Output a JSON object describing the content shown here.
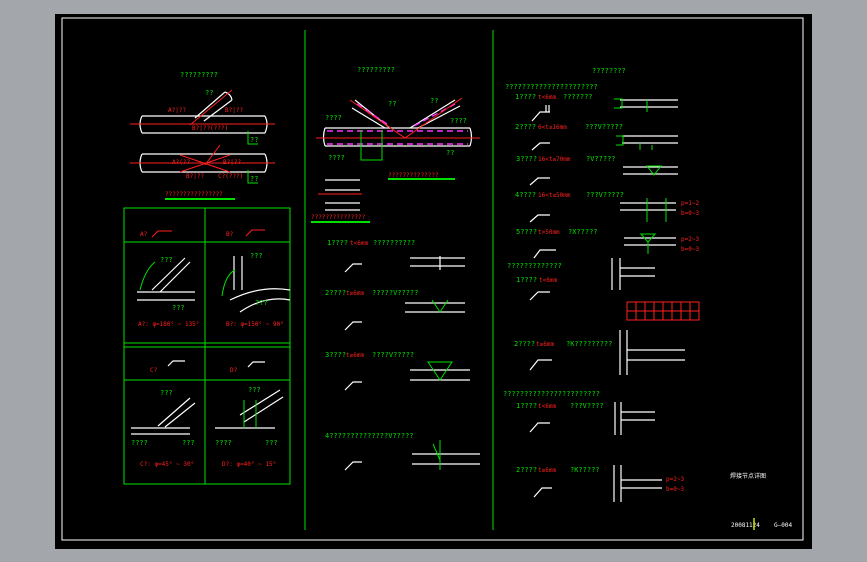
{
  "colors": {
    "background": "#a3a6aa",
    "sheet": "#000000",
    "accent_green": "#00e000",
    "accent_red": "#ff2020",
    "line_white": "#ffffff"
  },
  "left": {
    "title": "?????????",
    "labels": [
      "??",
      "A?|??",
      "B?|??",
      "B?|??(???)",
      "??",
      "A?(??",
      "B?|??",
      "B?|??",
      "C?(???)",
      "??"
    ],
    "caption": "????????????????",
    "table": {
      "cells": [
        {
          "id": "A?",
          "range": "A?: φ=180° ~ 135°",
          "top": "???",
          "bottom": "???"
        },
        {
          "id": "B?",
          "range": "B?: φ=150° ~ 90°",
          "top": "???",
          "bottom": "???"
        },
        {
          "id": "C?",
          "range": "C?: φ=45° ~ 30°",
          "top": "???",
          "bottom": "????",
          "bottom2": "???"
        },
        {
          "id": "D?",
          "range": "D?: φ=40° ~ 15°",
          "top": "???",
          "bottom": "????",
          "bottom2": "???"
        }
      ]
    }
  },
  "middle": {
    "title": "?????????",
    "labels": [
      "????",
      "??",
      "??",
      "????",
      "????",
      "??"
    ],
    "caption1": "??????????????",
    "caption2": "???????????????",
    "rows": [
      {
        "num": "1????",
        "spec": "t<6mm",
        "type": "??????????"
      },
      {
        "num": "2????",
        "spec": "t≥6mm",
        "type": "?????V?????"
      },
      {
        "num": "3????",
        "spec": "t≥6mm",
        "type": "????V?????"
      },
      {
        "num": "4??????????????V?????",
        "spec": "",
        "type": ""
      }
    ]
  },
  "right": {
    "title": "????????",
    "section1": "??????????????????????",
    "rows1": [
      {
        "num": "1????",
        "spec": "t<6mm",
        "type": "???????"
      },
      {
        "num": "2????",
        "spec": "6<t≤16mm",
        "type": "???V?????"
      },
      {
        "num": "3????",
        "spec": "16<t≤70mm",
        "type": "?V?????"
      },
      {
        "num": "4????",
        "spec": "16<t≤50mm",
        "type": "???V?????",
        "note1": "p=1~2",
        "note2": "b=0~3"
      },
      {
        "num": "5????",
        "spec": "t>50mm",
        "type": "?X?????",
        "note1": "p=2~3",
        "note2": "b=0~3"
      }
    ],
    "section2": "?????????????",
    "rows2": [
      {
        "num": "1????",
        "spec": "t<6mm",
        "type": ""
      }
    ],
    "row_2b": {
      "num": "2????",
      "spec": "t≥6mm",
      "type": "?K?????????"
    },
    "section3": "???????????????????????",
    "rows3": [
      {
        "num": "1????",
        "spec": "t<6mm",
        "type": "???V????"
      },
      {
        "num": "2????",
        "spec": "t≥6mm",
        "type": "?K?????",
        "note1": "p=2~3",
        "note2": "b=0~3"
      }
    ]
  },
  "title_block": {
    "drawing_title": "焊接节点详图",
    "scale": "20081124",
    "sheet_no": "G—004"
  }
}
